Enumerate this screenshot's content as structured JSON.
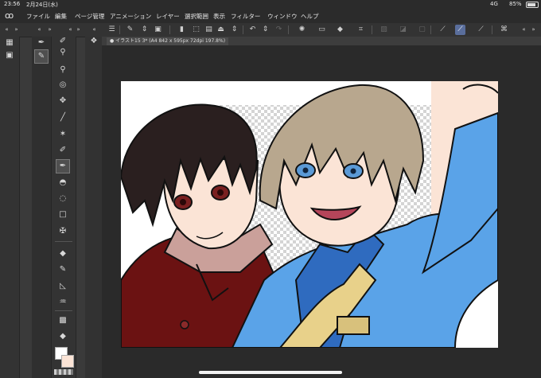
{
  "status_bar": {
    "time": "23:56",
    "date": "2月24日(水)",
    "network": "4G",
    "battery": "85%"
  },
  "menu": {
    "logo": "app-logo-icon",
    "items": [
      "ファイル",
      "編集",
      "ページ管理",
      "アニメーション",
      "レイヤー",
      "選択範囲",
      "表示",
      "フィルター",
      "ウィンドウ",
      "ヘルプ"
    ]
  },
  "document": {
    "tab_label": "● イラスト15 3* (A4 842 x 595px 72dpi 197.8%)"
  },
  "tools": {
    "active": "pen-tool",
    "items": [
      "move-layer-tool",
      "eyedropper-tool",
      "zoom-tool",
      "lasso-select-tool",
      "move-tool",
      "line-tool",
      "magic-wand-tool",
      "marker-tool",
      "pen-tool",
      "fill-tool",
      "blur-tool",
      "rectangle-tool",
      "transform-tool",
      "paint-bucket-tool",
      "pen-tool-2",
      "vector-tool",
      "droplet-tool",
      "gradient-tool",
      "eraser-tool"
    ]
  },
  "colors": {
    "main": "#ffffff",
    "sub": "#fbe4d6",
    "accent": "#5a6e9c"
  }
}
